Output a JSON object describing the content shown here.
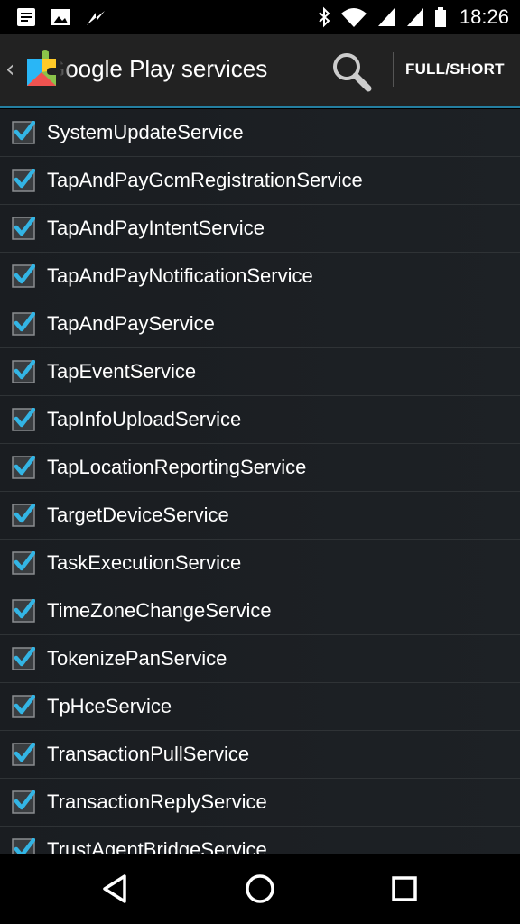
{
  "status_bar": {
    "time": "18:26",
    "left_icons": [
      "notes-icon",
      "image-icon",
      "signal-bolt-icon"
    ],
    "right_icons": [
      "bluetooth-icon",
      "wifi-icon",
      "cell-signal-icon",
      "cell-signal-2-icon",
      "battery-icon"
    ]
  },
  "action_bar": {
    "title": "Google Play services",
    "mode_label": "FULL/SHORT",
    "accent": "#33b5e5"
  },
  "services": [
    {
      "label": "SystemUpdateService",
      "checked": true
    },
    {
      "label": "TapAndPayGcmRegistrationService",
      "checked": true
    },
    {
      "label": "TapAndPayIntentService",
      "checked": true
    },
    {
      "label": "TapAndPayNotificationService",
      "checked": true
    },
    {
      "label": "TapAndPayService",
      "checked": true
    },
    {
      "label": "TapEventService",
      "checked": true
    },
    {
      "label": "TapInfoUploadService",
      "checked": true
    },
    {
      "label": "TapLocationReportingService",
      "checked": true
    },
    {
      "label": "TargetDeviceService",
      "checked": true
    },
    {
      "label": "TaskExecutionService",
      "checked": true
    },
    {
      "label": "TimeZoneChangeService",
      "checked": true
    },
    {
      "label": "TokenizePanService",
      "checked": true
    },
    {
      "label": "TpHceService",
      "checked": true
    },
    {
      "label": "TransactionPullService",
      "checked": true
    },
    {
      "label": "TransactionReplyService",
      "checked": true
    },
    {
      "label": "TrustAgentBridgeService",
      "checked": true
    }
  ],
  "nav_bar": {
    "buttons": [
      "back-icon",
      "home-icon",
      "recents-icon"
    ]
  }
}
